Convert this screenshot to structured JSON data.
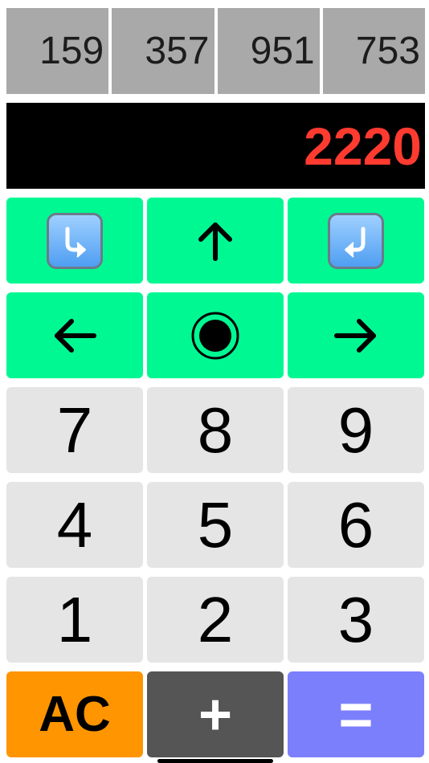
{
  "numbers": [
    "159",
    "357",
    "951",
    "753"
  ],
  "display": {
    "value": "2220",
    "color": "#ff3b30"
  },
  "nav_keys": [
    {
      "name": "redo-right-icon"
    },
    {
      "name": "up-arrow-icon"
    },
    {
      "name": "undo-left-icon"
    },
    {
      "name": "left-arrow-icon"
    },
    {
      "name": "center-select-icon"
    },
    {
      "name": "right-arrow-icon"
    }
  ],
  "keys": {
    "digits": [
      "7",
      "8",
      "9",
      "4",
      "5",
      "6",
      "1",
      "2",
      "3"
    ],
    "ac": "AC",
    "plus": "+",
    "equals": "="
  },
  "colors": {
    "nav_key": "#00f893",
    "digit_key": "#e5e5e5",
    "ac_key": "#ff9500",
    "plus_key": "#555555",
    "equals_key": "#7c7ffc",
    "number_cell": "#a9a9a9",
    "display_bg": "#000000"
  }
}
